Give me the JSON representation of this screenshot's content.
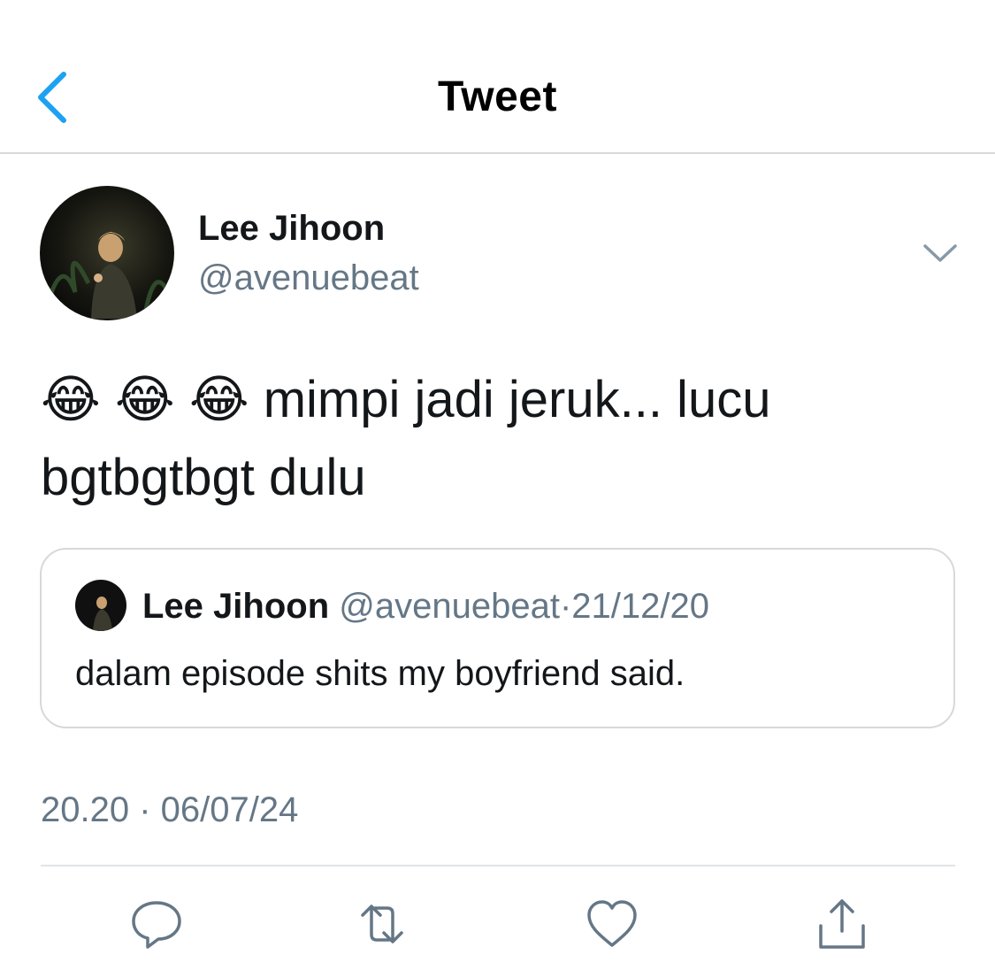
{
  "header": {
    "title": "Tweet",
    "back_icon": "chevron-left-icon"
  },
  "author": {
    "display_name": "Lee Jihoon",
    "handle": "@avenuebeat"
  },
  "tweet": {
    "emojis": [
      "😂",
      "😂",
      "😂"
    ],
    "text_line1": "mimpi jadi jeruk... lucu",
    "text_line2": "bgtbgtbgt dulu",
    "timestamp": "20.20 · 06/07/24"
  },
  "quoted_tweet": {
    "display_name": "Lee Jihoon",
    "handle": "@avenuebeat",
    "separator": "·",
    "date": "21/12/20",
    "text": "dalam episode shits my boyfriend said."
  },
  "actions": {
    "icons": [
      "reply-icon",
      "retweet-icon",
      "like-icon",
      "share-icon"
    ]
  },
  "colors": {
    "accent": "#1da1f2",
    "secondary_text": "#657786",
    "primary_text": "#14171a",
    "border": "#d6d9dc"
  }
}
